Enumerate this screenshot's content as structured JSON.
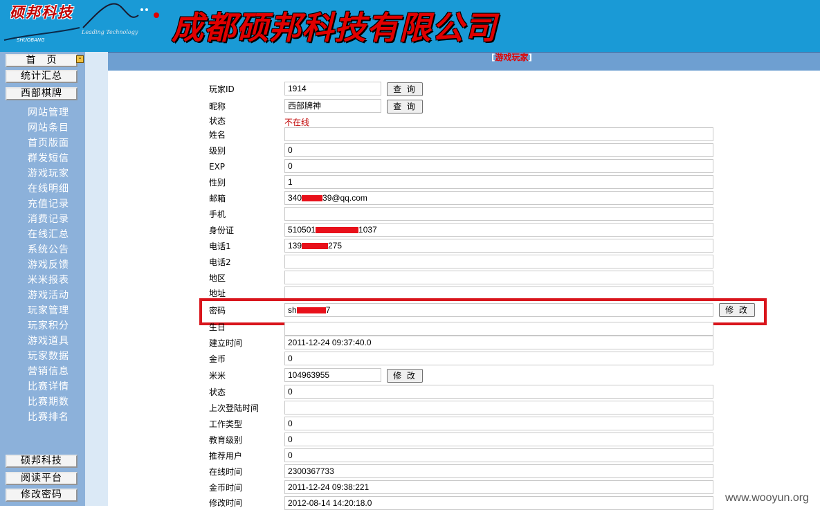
{
  "header": {
    "logo_text": "硕邦科技",
    "logo_sub": "Leading Technology",
    "logo_small": "SHUOBANG",
    "company_title": "成都硕邦科技有限公司"
  },
  "sidebar": {
    "top_buttons": [
      "首　页",
      "统计汇总",
      "西部棋牌"
    ],
    "links": [
      "网站管理",
      "网站条目",
      "首页版面",
      "群发短信",
      "游戏玩家",
      "在线明细",
      "充值记录",
      "消费记录",
      "在线汇总",
      "系统公告",
      "游戏反馈",
      "米米报表",
      "游戏活动",
      "玩家管理",
      "玩家积分",
      "游戏道具",
      "玩家数据",
      "营销信息",
      "比赛详情",
      "比赛期数",
      "比赛排名"
    ],
    "bottom_buttons": [
      "硕邦科技",
      "阅读平台",
      "修改密码"
    ]
  },
  "page_title": {
    "open": "[",
    "text": "游戏玩家",
    "close": "]"
  },
  "buttons": {
    "query": "查 询",
    "modify": "修 改"
  },
  "form": {
    "player_id_label": "玩家ID",
    "player_id": "1914",
    "nickname_label": "昵称",
    "nickname": "西部牌神",
    "status_label": "状态",
    "status_value": "不在线",
    "name_label": "姓名",
    "name": "",
    "level_label": "级别",
    "level": "0",
    "exp_label": "EXP",
    "exp": "0",
    "gender_label": "性别",
    "gender": "1",
    "email_label": "邮箱",
    "email_pre": "340",
    "email_post": "39@qq.com",
    "mobile_label": "手机",
    "mobile": "",
    "idcard_label": "身份证",
    "idcard_pre": "510501",
    "idcard_post": "1037",
    "phone1_label": "电话1",
    "phone1_pre": "139",
    "phone1_post": "275",
    "phone2_label": "电话2",
    "phone2": "",
    "region_label": "地区",
    "region": "",
    "address_label": "地址",
    "address": "",
    "password_label": "密码",
    "password_pre": "sh",
    "password_post": "7",
    "birthday_label": "生日",
    "birthday": "",
    "created_label": "建立时间",
    "created": "2011-12-24 09:37:40.0",
    "gold_label": "金币",
    "gold": "0",
    "mimi_label": "米米",
    "mimi": "104963955",
    "status2_label": "状态",
    "status2": "0",
    "last_login_label": "上次登陆时间",
    "last_login": "",
    "job_label": "工作类型",
    "job": "0",
    "edu_label": "教育级别",
    "edu": "0",
    "referrer_label": "推荐用户",
    "referrer": "0",
    "online_time_label": "在线时间",
    "online_time": "2300367733",
    "gold_time_label": "金币时间",
    "gold_time": "2011-12-24 09:38:221",
    "modified_label": "修改时间",
    "modified": "2012-08-14 14:20:18.0"
  },
  "watermark": "www.wooyun.org"
}
